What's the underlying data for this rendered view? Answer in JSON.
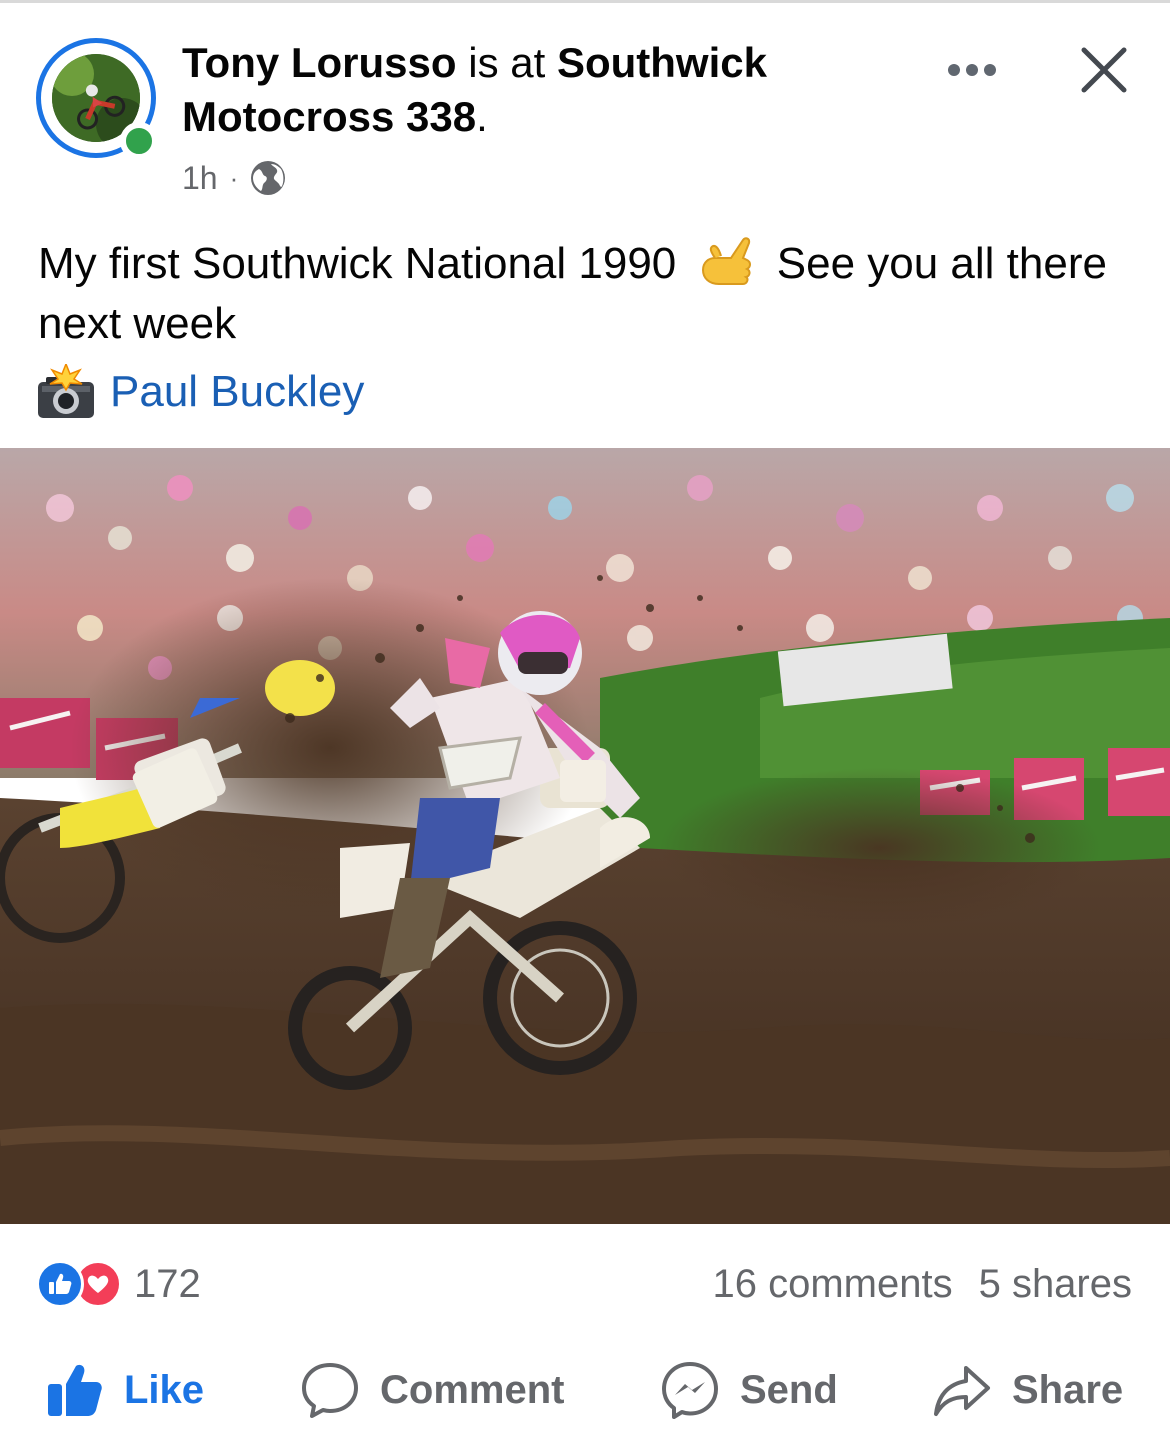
{
  "post": {
    "author": "Tony Lorusso",
    "is_at": "is at",
    "place": "Southwick Motocross 338",
    "place_suffix": ".",
    "time": "1h",
    "separator": "·",
    "audience_icon": "globe-icon",
    "more_icon": "more-options-icon",
    "close_icon": "close-icon"
  },
  "caption": {
    "text_1": "My first Southwick National 1990",
    "emoji": "call-me-hand-emoji",
    "text_2": "See you all there next week",
    "credit_icon": "camera-flash-emoji",
    "credit_name": "Paul Buckley"
  },
  "photo": {
    "subject": "motocross-race-photo"
  },
  "engagement": {
    "reaction_icons": [
      "like-reaction-icon",
      "love-reaction-icon"
    ],
    "reaction_count": "172",
    "comments": "16 comments",
    "shares": "5 shares"
  },
  "actions": {
    "like": "Like",
    "comment": "Comment",
    "send": "Send",
    "share": "Share"
  },
  "colors": {
    "facebook_blue": "#1b74e4",
    "link_blue": "#1a5fb4",
    "online_green": "#31a24c",
    "love_red": "#f33e58",
    "muted_gray": "#65676b"
  }
}
